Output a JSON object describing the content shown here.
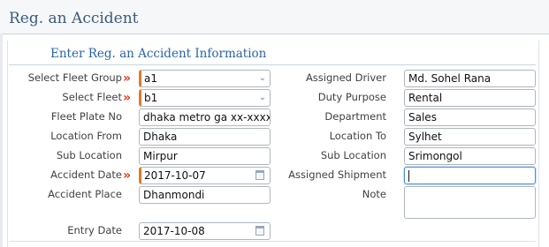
{
  "header": {
    "title": "Reg. an Accident"
  },
  "form": {
    "section_title": "Enter Reg. an Accident Information",
    "required_mark": "»",
    "left": {
      "fleet_group": {
        "label": "Select Fleet Group",
        "value": "a1"
      },
      "fleet": {
        "label": "Select Fleet",
        "value": "b1"
      },
      "plate_no": {
        "label": "Fleet Plate No",
        "value": "dhaka metro ga xx-xxxx"
      },
      "location_from": {
        "label": "Location From",
        "value": "Dhaka"
      },
      "sub_location": {
        "label": "Sub Location",
        "value": "Mirpur"
      },
      "accident_date": {
        "label": "Accident Date",
        "value": "2017-10-07"
      },
      "accident_place": {
        "label": "Accident Place",
        "value": "Dhanmondi"
      },
      "entry_date": {
        "label": "Entry Date",
        "value": "2017-10-08"
      }
    },
    "right": {
      "assigned_driver": {
        "label": "Assigned Driver",
        "value": "Md. Sohel Rana"
      },
      "duty_purpose": {
        "label": "Duty Purpose",
        "value": "Rental"
      },
      "department": {
        "label": "Department",
        "value": "Sales"
      },
      "location_to": {
        "label": "Location To",
        "value": "Sylhet"
      },
      "sub_location": {
        "label": "Sub Location",
        "value": "Srimongol"
      },
      "assigned_shipment": {
        "label": "Assigned Shipment",
        "value": ""
      },
      "note": {
        "label": "Note",
        "value": ""
      }
    }
  },
  "icons": {
    "dropdown": "chevron-down-icon",
    "calendar": "calendar-icon"
  },
  "colors": {
    "accent": "#2b63a8",
    "required": "#e03b24",
    "focus": "#4a8fd8"
  }
}
